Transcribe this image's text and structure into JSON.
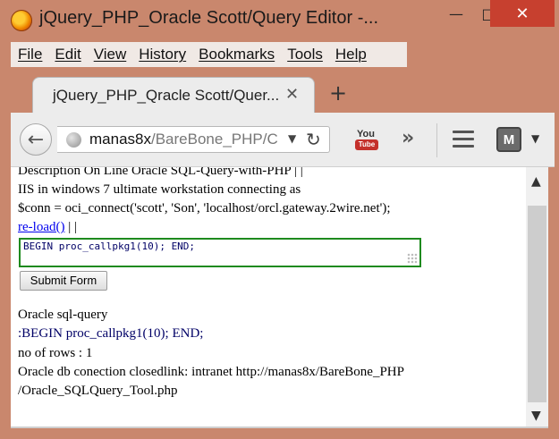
{
  "window": {
    "title": "jQuery_PHP_Oracle Scott/Query Editor -...",
    "minimize": "—",
    "maximize": "□",
    "close": "✕"
  },
  "menubar": {
    "items": [
      "File",
      "Edit",
      "View",
      "History",
      "Bookmarks",
      "Tools",
      "Help"
    ]
  },
  "tabs": {
    "active_title": "jQuery_PHP_Qracle Scott/Quer...",
    "close": "✕",
    "new_tab": "+"
  },
  "navbar": {
    "back": "←",
    "url_host": "manas8x",
    "url_path": "/BareBone_PHP/C",
    "dropdown": "▼",
    "reload": "↻",
    "youtube_top": "You",
    "youtube_bottom": "Tube",
    "overflow": "»",
    "extension_letter": "M",
    "extension_drop": "▼"
  },
  "content": {
    "line1": "Description On Line Oracle SQL-Query-with-PHP | |",
    "line2": "IIS in windows 7 ultimate workstation connecting as",
    "line3": "$conn = oci_connect('scott', 'Son', 'localhost/orcl.gateway.2wire.net');",
    "reload_link": "re-load()",
    "reload_suffix": " | |",
    "query_text": "BEGIN proc_callpkg1(10); END;",
    "submit_label": "Submit Form",
    "result_heading": "Oracle sql-query",
    "result_query": ":BEGIN proc_callpkg1(10); END;",
    "rows": "no of rows : 1",
    "closed_line": "Oracle db conection closedlink: intranet http://manas8x/BareBone_PHP",
    "closed_line2": "/Oracle_SQLQuery_Tool.php"
  },
  "scrollbar": {
    "up": "▲",
    "down": "▼"
  },
  "colors": {
    "chrome": "#c9876d",
    "close_button": "#c7402f",
    "editor_border": "#1e8a1e",
    "query_text": "#000066",
    "link": "#0000ee"
  }
}
